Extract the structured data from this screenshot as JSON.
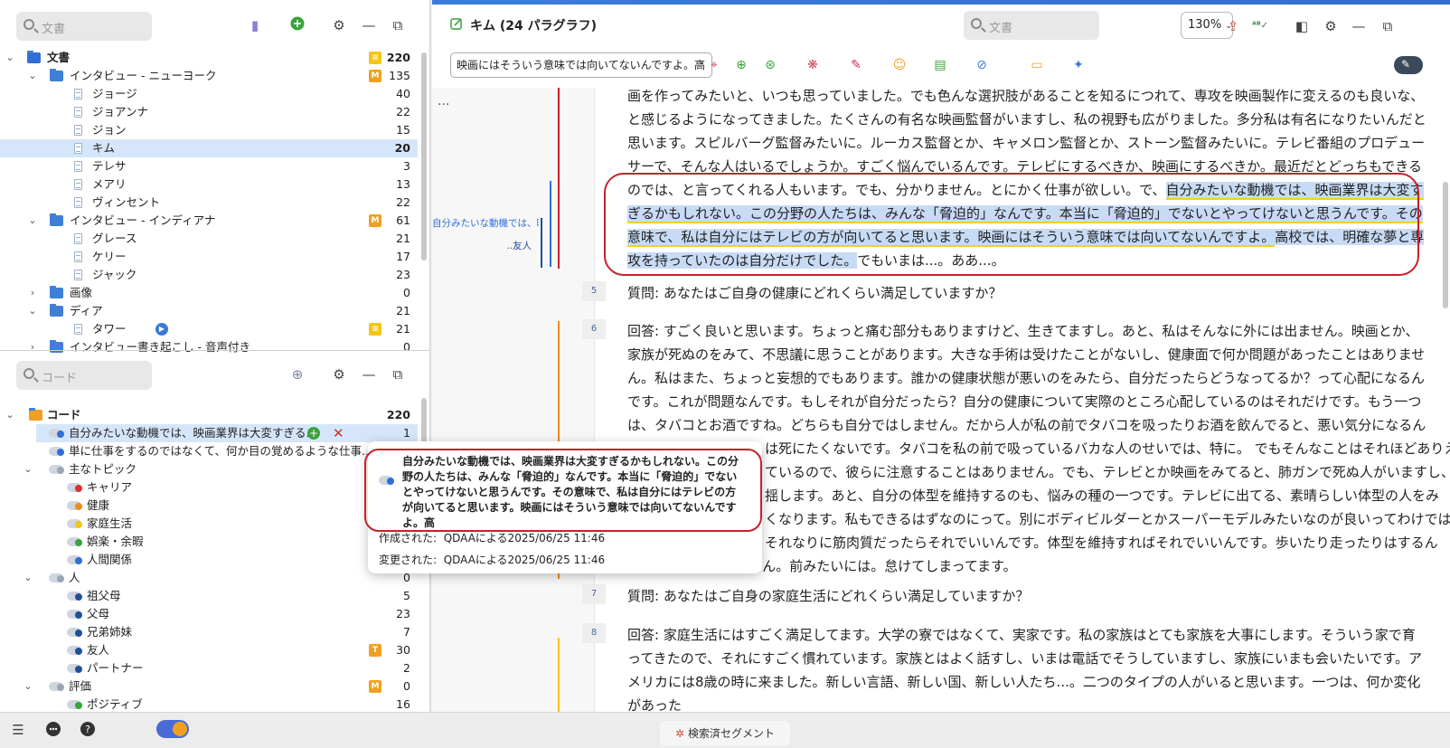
{
  "docs_pane": {
    "search_placeholder": "文書",
    "tree": [
      {
        "label": "文書",
        "count": "220",
        "memo": "note",
        "bold": true
      },
      {
        "label": "インタビュー - ニューヨーク",
        "count": "135",
        "memo": "M"
      },
      {
        "label": "ジョージ",
        "count": "40"
      },
      {
        "label": "ジョアンナ",
        "count": "22"
      },
      {
        "label": "ジョン",
        "count": "15"
      },
      {
        "label": "キム",
        "count": "20",
        "selected": true
      },
      {
        "label": "テレサ",
        "count": "3"
      },
      {
        "label": "メアリ",
        "count": "13"
      },
      {
        "label": "ヴィンセント",
        "count": "22"
      },
      {
        "label": "インタビュー - インディアナ",
        "count": "61",
        "memo": "M"
      },
      {
        "label": "グレース",
        "count": "21"
      },
      {
        "label": "ケリー",
        "count": "17"
      },
      {
        "label": "ジャック",
        "count": "23"
      },
      {
        "label": "画像",
        "count": "0"
      },
      {
        "label": "ディア",
        "count": "21"
      },
      {
        "label": "タワー",
        "count": "21",
        "memo": "note"
      },
      {
        "label": "インタビュー書き起こし - 音声付き",
        "count": "0"
      }
    ]
  },
  "codes_pane": {
    "search_placeholder": "コード",
    "tree": [
      {
        "label": "コード",
        "count": "220",
        "bold": true
      },
      {
        "label": "自分みたいな動機では、映画業界は大変すぎる...",
        "count": "1",
        "selected": true,
        "color": "#2f6fd6"
      },
      {
        "label": "単に仕事をするのではなくて、何か目の覚めるような仕事...",
        "count": "",
        "color": "#2f6fd6"
      },
      {
        "label": "主なトピック",
        "count": "",
        "color": "#9aa5b5"
      },
      {
        "label": "キャリア",
        "count": "",
        "color": "#e0302a"
      },
      {
        "label": "健康",
        "count": "",
        "color": "#f08a1c"
      },
      {
        "label": "家庭生活",
        "count": "",
        "color": "#f5c518"
      },
      {
        "label": "娯楽・余暇",
        "count": "",
        "color": "#3aa33a"
      },
      {
        "label": "人間関係",
        "count": "",
        "color": "#2f6fd6"
      },
      {
        "label": "人",
        "count": "0",
        "color": "#9aa5b5"
      },
      {
        "label": "祖父母",
        "count": "5",
        "color": "#1f4f9a"
      },
      {
        "label": "父母",
        "count": "23",
        "color": "#1f4f9a"
      },
      {
        "label": "兄弟姉妹",
        "count": "7",
        "color": "#1f4f9a"
      },
      {
        "label": "友人",
        "count": "30",
        "memo": "T",
        "color": "#1f4f9a"
      },
      {
        "label": "パートナー",
        "count": "2",
        "color": "#1f4f9a"
      },
      {
        "label": "評価",
        "count": "0",
        "memo": "M",
        "color": "#9aa5b5"
      },
      {
        "label": "ポジティブ",
        "count": "16",
        "color": "#3aa33a"
      }
    ]
  },
  "header": {
    "doc_title": "キム (24 パラグラフ)",
    "search_placeholder": "文書",
    "zoom": "130%"
  },
  "segment_select": "映画にはそういう意味では向いてないんですよ。高",
  "gutter": {
    "ellipsis": "...",
    "code_label1": "自分みたいな動機では、映",
    "code_label2": "..友人"
  },
  "document": {
    "p4_pre": "画を作ってみたいと、いつも思っていました。でも色んな選択肢があることを知るにつれて、専攻を映画製作に変えるのも良いな、と感じるようになってきました。たくさんの有名な映画監督がいますし、私の視野も広がりました。多分私は有名になりたいんだと思います。スピルバーグ監督みたいに。ルーカス監督とか、キャメロン監督とか、ストーン監督みたいに。テレビ番組のプロデューサーで、そんな人はいるでしょうか。すごく悩んでいるんです。テレビにするべきか、映画にするべきか。最近だとどっちもできるのでは、と言ってくれる人もいます。でも、分かりません。とにかく仕事が欲しい。で、",
    "p4_hl1": "自分みたいな動機では、映画業界は大変すぎるかもしれない。この分野の人たちは、みんな「脅迫的」なんです。本当に「脅迫的」でないとやってけないと思うんです。その意味で、私は自分にはテレビの方が向いてると思います。映画にはそういう意味では向いてないんですよ。",
    "p4_hl2": "高校では、明確な夢と専攻を持っていたのは自分だけでした。",
    "p4_post": "でもいまは...。ああ...。",
    "p5_num": "5",
    "p5": "質問: あなたはご自身の健康にどれくらい満足していますか？",
    "p6_num": "6",
    "p6_a": "回答: すごく良いと思います。ちょっと痛む部分もありますけど、生きてますし。あと、私はそんなに外には出ません。映画とか、家族が死ぬのをみて、不思議に思うことがあります。大きな手術は受けたことがないし、健康面で何か問題があったことはありません。私はまた、ちょっと妄想的でもあります。誰かの健康状態が悪いのをみたら、自分だったらどうなってるか？って心配になるんです。これが問題なんです。もしそれが自分だったら？自分の健康について実際のところ心配しているのはそれだけです。もう一つは、タバコとお酒ですね。どちらも自分ではしません。だから人が私の前でタバコを吸ったりお酒を飲んでると、悪い気分になるんです。副流煙",
    "p6_b": "は死にたくないです。タバコを私の前で吸っているバカな人のせいでは、特に。 でもそんなことはそれほどありえ",
    "p6_c": "ているので、彼らに注意することはありません。でも、テレビとか映画をみてると、肺ガンで死ぬ人がいますし、",
    "p6_d": "揺します。あと、自分の体型を維持するのも、悩みの種の一つです。テレビに出てる、素晴らしい体型の人をみ",
    "p6_e": "くなります。私もできるはずなのにって。別にボディビルダーとかスーパーモデルみたいなのが良いってわけでは",
    "p6_f": "それなりに筋肉質だったらそれでいいんです。体型を維持すればそれでいいんです。歩いたり走ったりはするん",
    "p6_g": "ですが、続けられません。前みたいには。怠けてしまってます。",
    "p7_num": "7",
    "p7": "質問: あなたはご自身の家庭生活にどれくらい満足していますか？",
    "p8_num": "8",
    "p8": "回答: 家庭生活にはすごく満足してます。大学の寮ではなくて、実家です。私の家族はとても家族を大事にします。そういう家で育ってきたので、それにすごく慣れています。家族とはよく話すし、いまは電話でそうしていますし、家族にいまも会いたいです。アメリカには8歳の時に来ました。新しい言語、新しい国、新しい人たち...。二つのタイプの人がいると思います。一つは、何か変化があった"
  },
  "tooltip": {
    "text": "自分みたいな動機では、映画業界は大変すぎるかもしれない。この分野の人たちは、みんな「脅迫的」なんです。本当に「脅迫的」でないとやってけないと思うんです。その意味で、私は自分にはテレビの方が向いてると思います。映画にはそういう意味では向いてないんですよ。高",
    "created_label": "作成された:",
    "created_value": "QDAAによる2025/06/25 11:46",
    "modified_label": "変更された:",
    "modified_value": "QDAAによる2025/06/25 11:46"
  },
  "bottom": {
    "retrieved_segments": "検索済セグメント"
  },
  "colors": {
    "accent": "#2f6fd6",
    "highlight_box": "#c8202a",
    "selection": "#c7dbf5"
  }
}
